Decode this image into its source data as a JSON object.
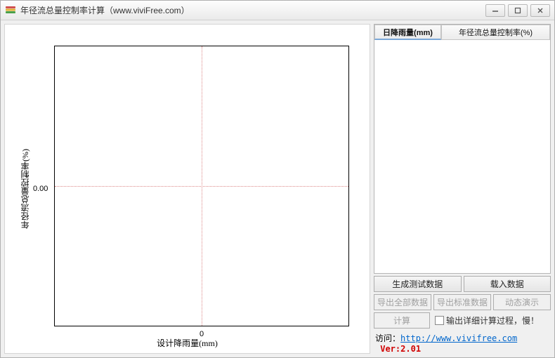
{
  "window": {
    "title": "年径流总量控制率计算（www.viviFree.com）"
  },
  "chart_data": {
    "type": "scatter",
    "title": "",
    "xlabel": "设计降雨量(mm)",
    "ylabel": "年径流总量控制率(%)",
    "xticks": [
      "0"
    ],
    "yticks": [
      "0.00"
    ],
    "series": [],
    "xlim": [
      0,
      0
    ],
    "ylim": [
      0,
      0
    ]
  },
  "table": {
    "col1": "日降雨量(mm)",
    "col2": "年径流总量控制率(%)",
    "rows": []
  },
  "buttons": {
    "gen": "生成测试数据",
    "load": "载入数据",
    "expAll": "导出全部数据",
    "expStd": "导出标准数据",
    "play": "动态演示",
    "calc": "计算"
  },
  "checkbox_label": "输出详细计算过程，慢！",
  "footer": {
    "prefix": "访问：",
    "url": "http://www.vivifree.com",
    "ver_label": "Ver:",
    "ver": "2.01"
  }
}
